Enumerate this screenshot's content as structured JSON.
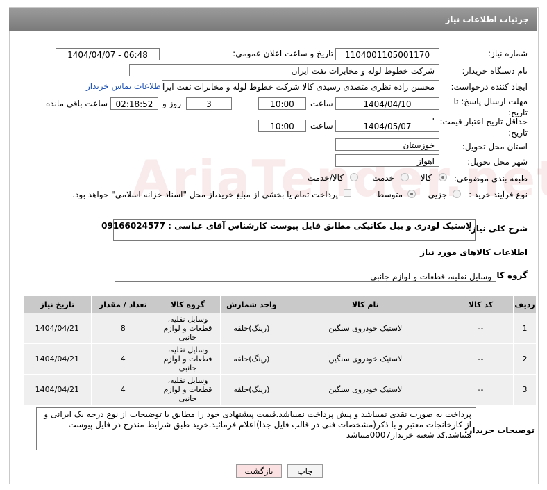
{
  "header": {
    "title": "جزئیات اطلاعات نیاز"
  },
  "fields": {
    "need_number_label": "شماره نیاز:",
    "need_number": "1104001105001170",
    "announce_label": "تاریخ و ساعت اعلان عمومی:",
    "announce_value": "1404/04/07 - 06:48",
    "buyer_org_label": "نام دستگاه خریدار:",
    "buyer_org": "شرکت خطوط لوله و مخابرات نفت ایران",
    "creator_label": "ایجاد کننده درخواست:",
    "creator": "محسن زاده نظری متصدی رسیدی کالا شرکت خطوط لوله و مخابرات نفت ایران",
    "contact_link": "اطلاعات تماس خریدار",
    "reply_deadline_label": "مهلت ارسال پاسخ: تا تاریخ:",
    "reply_date": "1404/04/10",
    "time_label": "ساعت",
    "reply_time": "10:00",
    "days_value": "3",
    "days_label": "روز و",
    "remaining_time": "02:18:52",
    "remaining_label": "ساعت باقی مانده",
    "price_deadline_label": "حداقل تاریخ اعتبار قیمت: تا تاریخ:",
    "price_date": "1404/05/07",
    "price_time": "10:00",
    "province_label": "استان محل تحویل:",
    "province": "خوزستان",
    "city_label": "شهر محل تحویل:",
    "city": "اهواز",
    "category_label": "طبقه بندی موضوعی:",
    "category_options": [
      "کالا",
      "خدمت",
      "کالا/خدمت"
    ],
    "process_label": "نوع فرآیند خرید :",
    "process_options": [
      "جزیی",
      "متوسط"
    ],
    "payment_note": "پرداخت تمام یا بخشی از مبلغ خرید،از محل \"اسناد خزانه اسلامی\" خواهد بود.",
    "desc_label": "شرح کلی نیاز:",
    "desc_value": "لاستیک لودری و بیل مکانیکی مطابق فایل پیوست کارشناس آقای عباسی : 09166024577",
    "goods_info_title": "اطلاعات کالاهای مورد نیاز",
    "goods_group_label": "گروه کالا:",
    "goods_group": "وسایل نقلیه، قطعات و لوازم جانبی"
  },
  "table": {
    "headers": [
      "ردیف",
      "کد کالا",
      "نام کالا",
      "واحد شمارش",
      "گروه کالا",
      "تعداد / مقدار",
      "تاریخ نیاز"
    ],
    "rows": [
      [
        "1",
        "--",
        "لاستیک خودروی سنگین",
        "(رینگ)حلقه",
        "وسایل نقلیه، قطعات و لوازم جانبی",
        "8",
        "1404/04/21"
      ],
      [
        "2",
        "--",
        "لاستیک خودروی سنگین",
        "(رینگ)حلقه",
        "وسایل نقلیه، قطعات و لوازم جانبی",
        "4",
        "1404/04/21"
      ],
      [
        "3",
        "--",
        "لاستیک خودروی سنگین",
        "(رینگ)حلقه",
        "وسایل نقلیه، قطعات و لوازم جانبی",
        "4",
        "1404/04/21"
      ]
    ]
  },
  "buyer_notes": {
    "label": "توضیحات خریدار:",
    "text": "پرداخت به صورت نقدی نمیباشد و پیش پرداخت نمیباشد.قیمت پیشنهادی خود را مطابق با توضیحات از نوع درجه یک ایرانی و از کارخانجات معتبر و با ذکر(مشخصات فنی در قالب فایل جدا)اعلام فرمائید.خرید طبق شرایط مندرج در فایل پیوست میباشد.کد شعبه خریدار0007میباشد"
  },
  "buttons": {
    "print": "چاپ",
    "back": "بازگشت"
  },
  "watermark": "AriaTender.net",
  "colors": {
    "header": "#8a8a8a",
    "link": "#1a4fb5",
    "back_button": "#fbe1e1"
  }
}
